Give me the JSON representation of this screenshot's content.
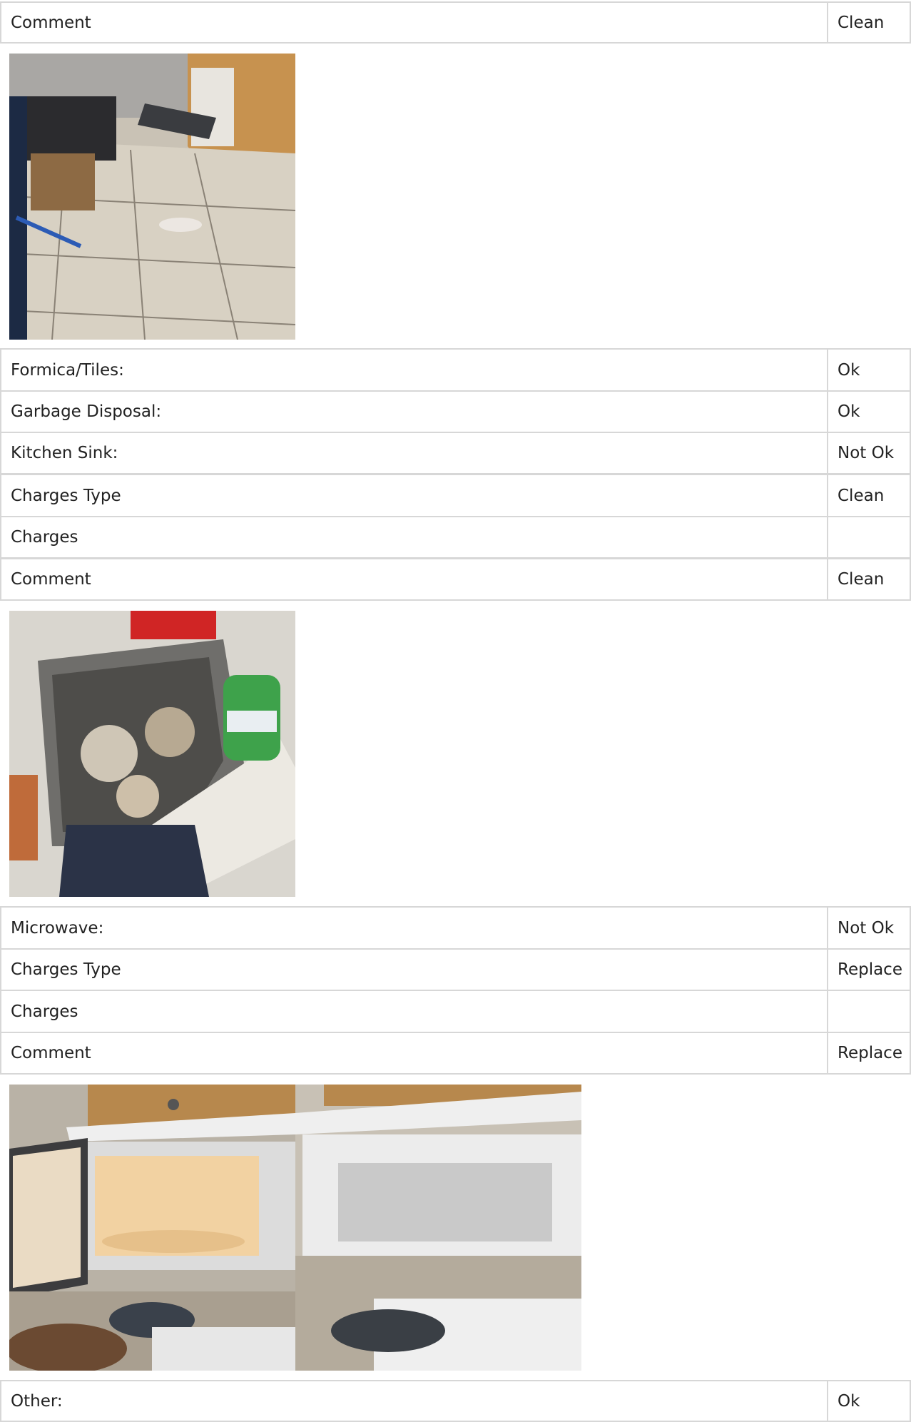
{
  "rows_top": [
    {
      "label": "Comment",
      "value": "Clean"
    }
  ],
  "rows_mid": [
    {
      "label": "Formica/Tiles:",
      "value": "Ok"
    },
    {
      "label": "Garbage Disposal:",
      "value": "Ok"
    },
    {
      "label": "Kitchen Sink:",
      "value": "Not Ok"
    },
    {
      "label": "Charges Type",
      "value": "Clean"
    },
    {
      "label": "Charges",
      "value": ""
    },
    {
      "label": "Comment",
      "value": "Clean"
    }
  ],
  "rows_micro": [
    {
      "label": "Microwave:",
      "value": "Not Ok"
    },
    {
      "label": "Charges Type",
      "value": "Replace"
    },
    {
      "label": "Charges",
      "value": ""
    },
    {
      "label": "Comment",
      "value": "Replace"
    }
  ],
  "rows_bottom": [
    {
      "label": "Other:",
      "value": "Ok"
    }
  ],
  "photos": {
    "kitchen_floor": "kitchen-floor-photo",
    "kitchen_sink": "kitchen-sink-photo",
    "microwave_open": "microwave-open-photo",
    "microwave_closed": "microwave-closed-photo"
  }
}
